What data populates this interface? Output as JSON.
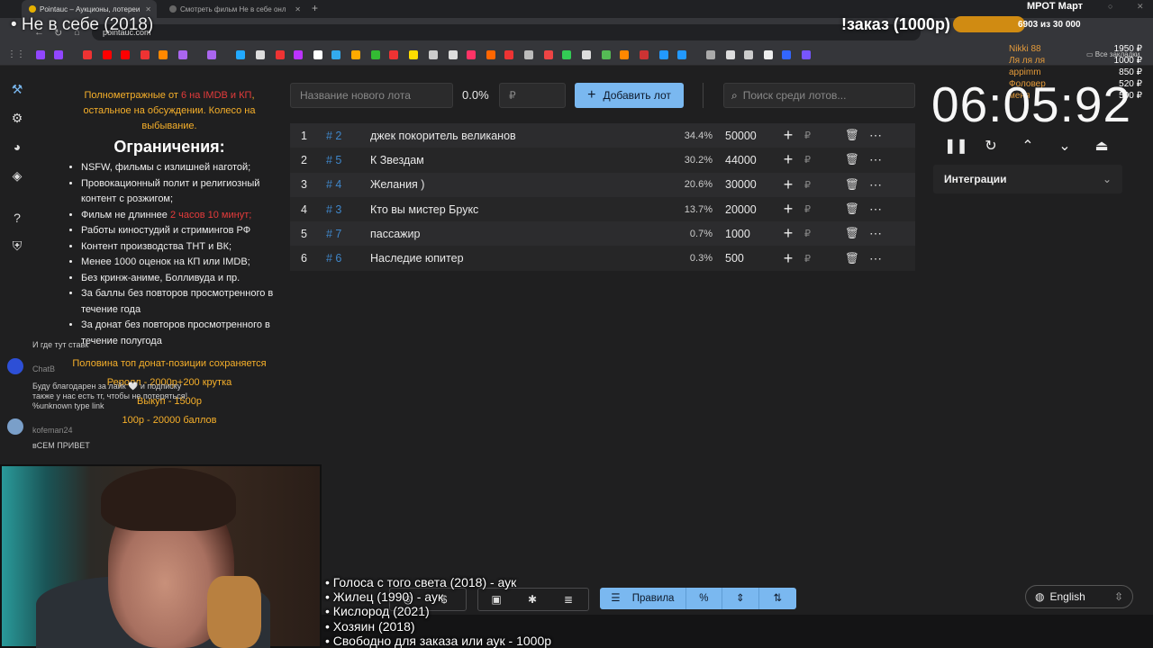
{
  "browser": {
    "tabs": [
      {
        "label": "Pointauc – Аукционы, лотереи"
      },
      {
        "label": "Смотреть фильм Не в себе онл"
      }
    ],
    "url": "pointauc.com",
    "bookmarks_folder": "Все закладки"
  },
  "overlay": {
    "title": "• Не в себе (2018)",
    "order_label": "!заказ (1000р)",
    "mrot_label": "МРОТ Март",
    "mrot_progress": "6903  из 30 000",
    "donors": [
      "Nikki 88",
      "Ля ля ля",
      "appimm",
      "Фоловер",
      "меня"
    ],
    "donor_amounts": [
      "1950 ₽",
      "1000 ₽",
      "850 ₽",
      "520 ₽",
      "500 ₽"
    ]
  },
  "sidebar": {
    "icons": [
      "hammer-icon",
      "gear-icon",
      "pie-chart-icon",
      "layers-icon",
      "help-icon",
      "shield-icon"
    ]
  },
  "rules": {
    "header_pre": "Полнометражные от ",
    "header_red": "6 на IMDB и КП",
    "header_post": ", остальное на обсуждении. Колесо на выбывание.",
    "title": "Ограничения:",
    "items": [
      "NSFW, фильмы с излишней наготой;",
      "Провокационный полит и религиозный контент с розжигом;",
      "Фильм не длиннее ",
      "Работы киностудий и стримингов РФ",
      "Контент производства ТНТ и ВК;",
      "Менее 1000 оценок на КП или IMDB;",
      "Без кринж-аниме, Болливуда и пр.",
      "За баллы без повторов просмотренного в течение года",
      "За донат без повторов просмотренного в течение полугода"
    ],
    "duration_red": "2 часов 10 минут;",
    "footer": [
      "Половина топ донат-позиции сохраняется",
      "Реролл - 2000р+200 крутка",
      "Выкуп - 1500р",
      "100р - 20000 баллов"
    ]
  },
  "chat": {
    "messages": [
      "И где тут ставк",
      "ChatB",
      "Буду благодарен за лайк 🤍 и подписку",
      "также у нас есть тг, чтобы не потеряться!",
      "%unknown type link",
      "kofeman24",
      "вСЕМ ПРИВЕТ"
    ]
  },
  "controls": {
    "new_lot_placeholder": "Название нового лота",
    "percent": "0.0%",
    "amount_placeholder": "₽",
    "add_lot": "Добавить лот",
    "search_placeholder": "Поиск среди лотов..."
  },
  "lots": [
    {
      "idx": "1",
      "hash": "# 2",
      "name": "джек покоритель великанов",
      "pct": "34.4%",
      "amount": "50000"
    },
    {
      "idx": "2",
      "hash": "# 5",
      "name": "К Звездам",
      "pct": "30.2%",
      "amount": "44000"
    },
    {
      "idx": "3",
      "hash": "# 4",
      "name": "Желания )",
      "pct": "20.6%",
      "amount": "30000"
    },
    {
      "idx": "4",
      "hash": "# 3",
      "name": "Кто вы мистер Брукс",
      "pct": "13.7%",
      "amount": "20000"
    },
    {
      "idx": "5",
      "hash": "# 7",
      "name": "пассажир",
      "pct": "0.7%",
      "amount": "1000"
    },
    {
      "idx": "6",
      "hash": "# 6",
      "name": "Наследие юпитер",
      "pct": "0.3%",
      "amount": "500"
    }
  ],
  "lot_currency": "₽",
  "timer": {
    "value": "06:05:92",
    "integrations": "Интеграции"
  },
  "bottom": {
    "rules_button": "Правила",
    "language": "English",
    "ticker": [
      "• Голоса с того света (2018) - аук",
      "• Жилец (1990) - аук",
      "• Кислород (2021)",
      "• Хозяин (2018)",
      "• Свободно для заказа или аук - 1000р"
    ]
  },
  "colors": {
    "accent_blue": "#7ab8f0",
    "orange": "#f7b02a",
    "red": "#e53b3b",
    "hash_blue": "#3f86c9"
  }
}
